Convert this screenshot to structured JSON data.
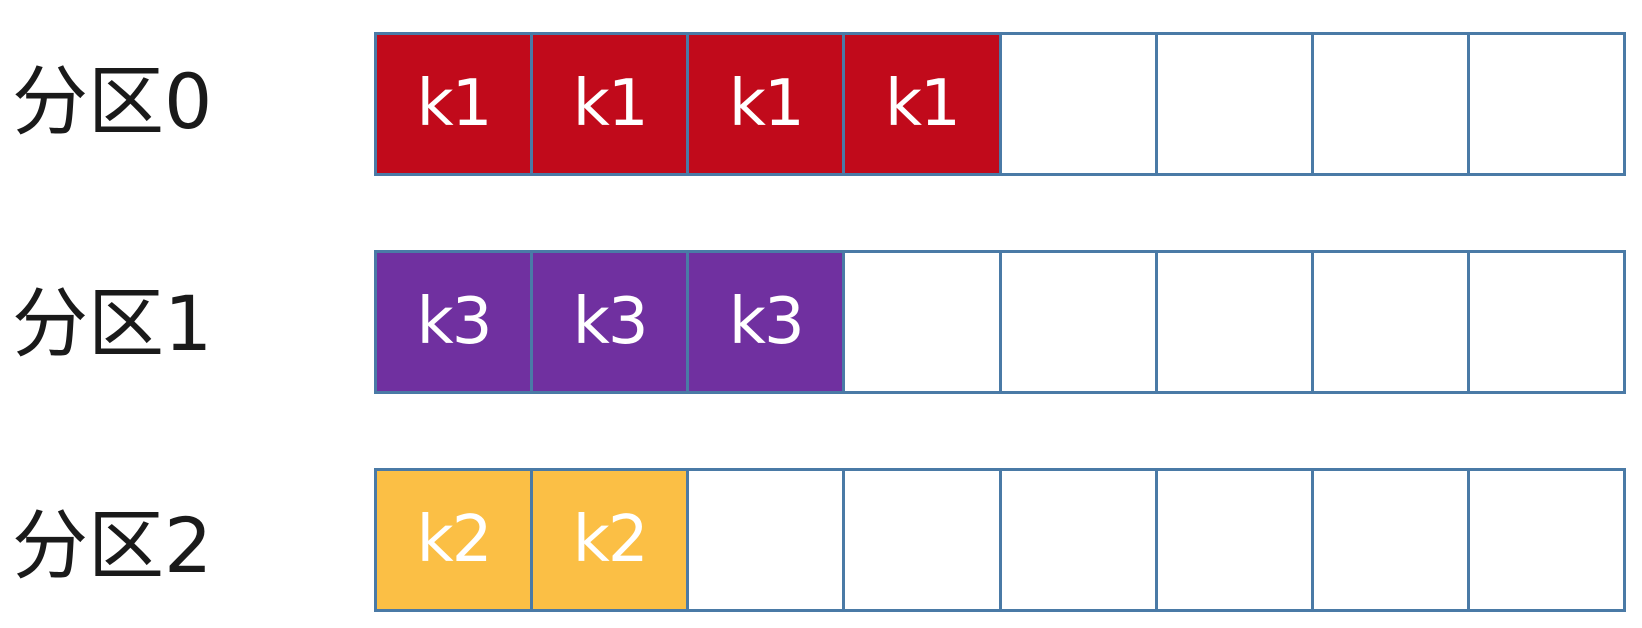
{
  "partitions": [
    {
      "label": "分区0",
      "cells": [
        "k1",
        "k1",
        "k1",
        "k1",
        "",
        "",
        "",
        ""
      ],
      "fill_color": "#c10a1b"
    },
    {
      "label": "分区1",
      "cells": [
        "k3",
        "k3",
        "k3",
        "",
        "",
        "",
        "",
        ""
      ],
      "fill_color": "#7030a0"
    },
    {
      "label": "分区2",
      "cells": [
        "k2",
        "k2",
        "",
        "",
        "",
        "",
        "",
        ""
      ],
      "fill_color": "#fbbf45"
    }
  ],
  "colors": {
    "cell_border": "#4a7aa6",
    "empty_cell": "#ffffff",
    "key_text": "#ffffff",
    "label_text": "#1a1a1a"
  }
}
